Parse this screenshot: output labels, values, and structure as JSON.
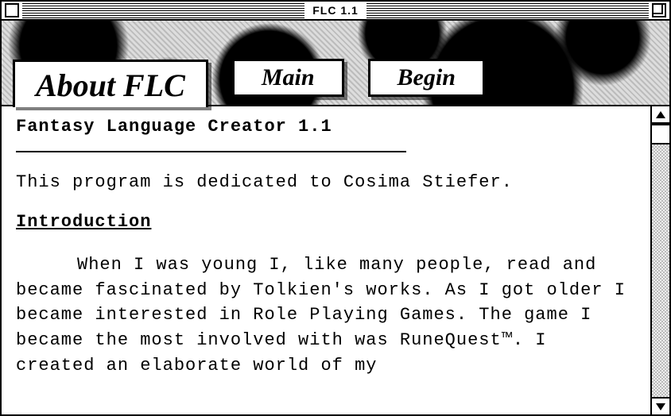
{
  "window": {
    "title": "FLC 1.1"
  },
  "tabs": {
    "active": "About FLC",
    "items": [
      "About FLC",
      "Main",
      "Begin"
    ]
  },
  "about": {
    "title": "Fantasy Language Creator 1.1",
    "dedication": "This program is dedicated to Cosima Stiefer.",
    "section_heading": "Introduction",
    "body": "When I was young I, like many people, read and became fascinated by Tolkien's works.  As I got older I became interested in Role Playing Games.  The game I became the most involved with was RuneQuest™.  I created an elaborate world of my"
  }
}
